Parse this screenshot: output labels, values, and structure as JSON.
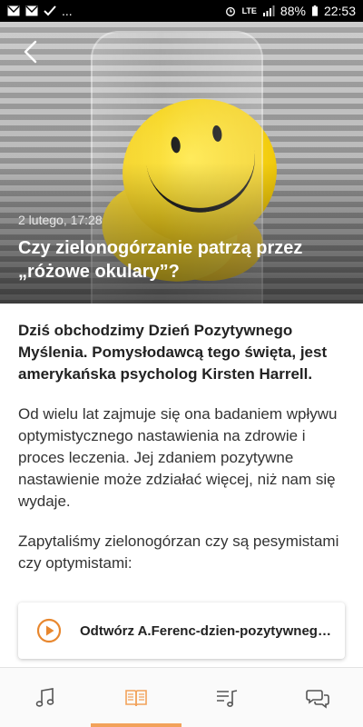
{
  "status_bar": {
    "more_indicator": "...",
    "network": "LTE",
    "battery": "88%",
    "time": "22:53"
  },
  "article": {
    "date": "2 lutego, 17:28",
    "title": "Czy zielonogórzanie patrzą przez „różowe okulary”?",
    "lead": "Dziś obchodzimy Dzień Pozytywnego Myślenia. Pomysłodawcą tego święta, jest amerykańska psycholog Kirsten Harrell.",
    "paragraphs": [
      "Od wielu lat zajmuje się ona badaniem wpływu optymistycznego nastawienia na zdrowie i proces leczenia. Jej zdaniem pozytywne nastawienie może zdziałać więcej, niż nam się wydaje.",
      "Zapytaliśmy zielonogórzan czy są pesymistami czy optymistami:"
    ],
    "audio_label": "Odtwórz A.Ferenc-dzien-pozytywnego-myslenia"
  },
  "bottom_nav": {
    "items": [
      {
        "icon": "music-note-icon",
        "active": false
      },
      {
        "icon": "book-open-icon",
        "active": true
      },
      {
        "icon": "playlist-icon",
        "active": false
      },
      {
        "icon": "chat-bubbles-icon",
        "active": false
      }
    ]
  },
  "colors": {
    "accent": "#f2a25a",
    "play_accent": "#e8872e",
    "status_bar": "#000000"
  }
}
